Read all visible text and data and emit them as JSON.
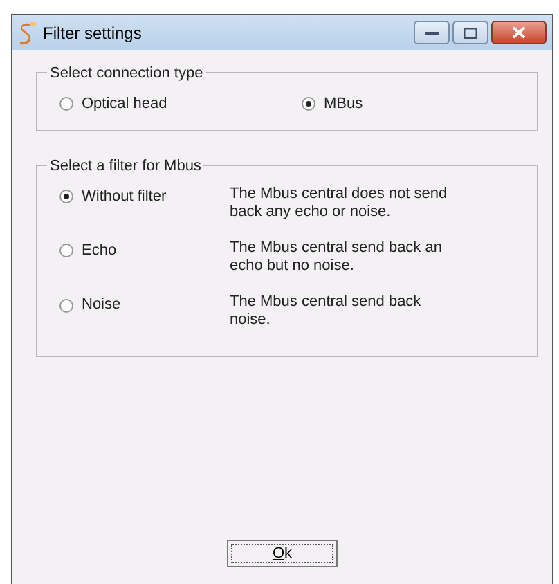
{
  "window": {
    "title": "Filter settings"
  },
  "connection_group": {
    "title": "Select connection type",
    "options": [
      {
        "label": "Optical head",
        "selected": false
      },
      {
        "label": "MBus",
        "selected": true
      }
    ]
  },
  "filter_group": {
    "title": "Select a filter for Mbus",
    "options": [
      {
        "label": "Without filter",
        "description": "The Mbus central does not send back any echo or noise.",
        "selected": true
      },
      {
        "label": "Echo",
        "description": "The Mbus central send back an echo but no noise.",
        "selected": false
      },
      {
        "label": "Noise",
        "description": "The Mbus central send back noise.",
        "selected": false
      }
    ]
  },
  "ok_button": {
    "label": "Ok"
  }
}
